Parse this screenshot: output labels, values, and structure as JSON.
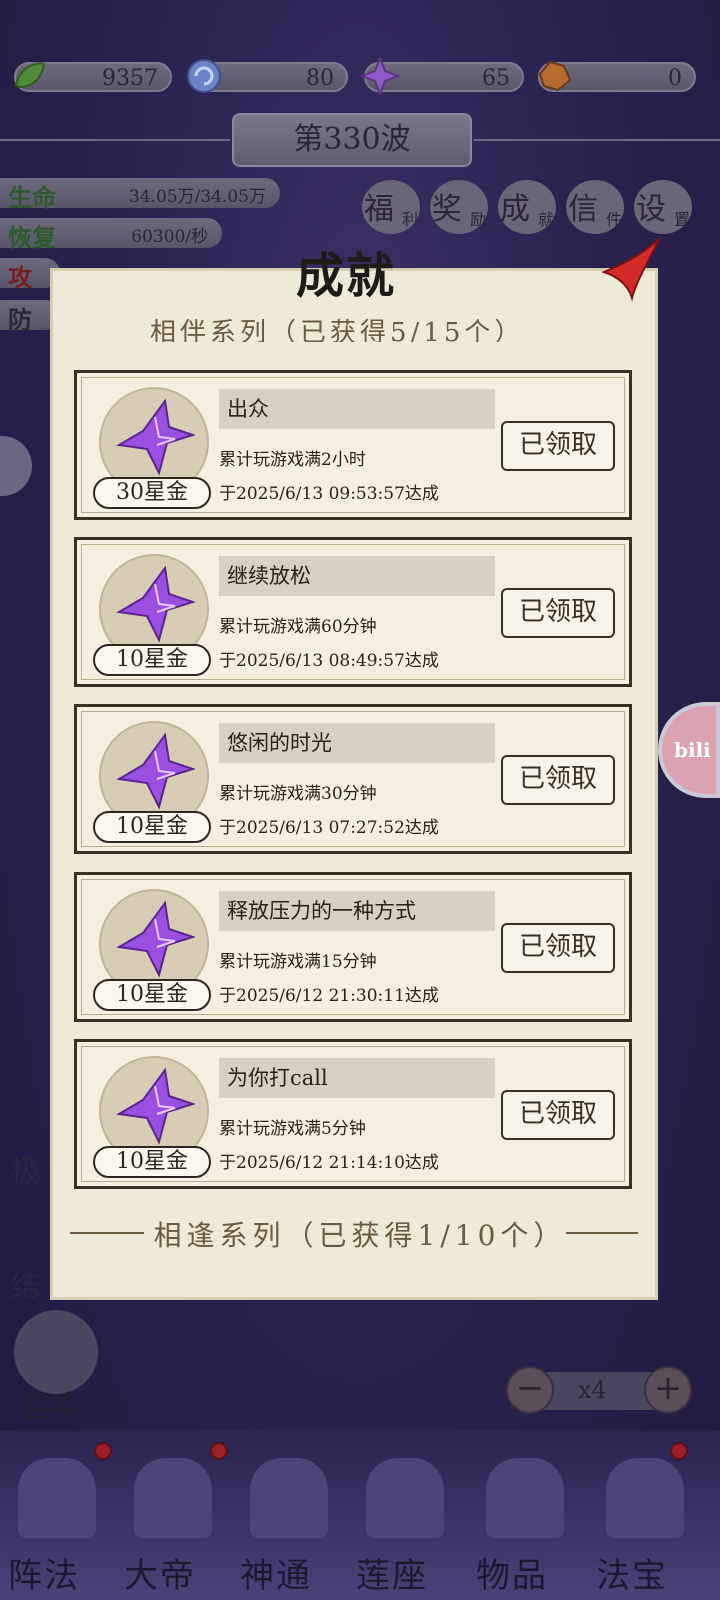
{
  "resources": [
    {
      "icon": "green-leaf-icon",
      "value": "9357"
    },
    {
      "icon": "blue-orb-icon",
      "value": "80"
    },
    {
      "icon": "purple-star-icon",
      "value": "65"
    },
    {
      "icon": "orange-ore-icon",
      "value": "0"
    }
  ],
  "wave": {
    "label": "第330波"
  },
  "stats": [
    {
      "label": "生命",
      "value": "34.05万/34.05万"
    },
    {
      "label": "恢复",
      "value": "60300/秒"
    },
    {
      "label": "攻"
    },
    {
      "label": "防"
    }
  ],
  "quick_buttons": [
    {
      "big": "福",
      "small": "利"
    },
    {
      "big": "奖",
      "small": "励"
    },
    {
      "big": "成",
      "small": "就"
    },
    {
      "big": "信",
      "small": "件"
    },
    {
      "big": "设",
      "small": "置"
    }
  ],
  "modal": {
    "title": "成就",
    "top_series": "相伴系列（已获得5/15个）",
    "cards": [
      {
        "name": "出众",
        "desc": "累计玩游戏满2小时",
        "date": "于2025/6/13 09:53:57达成",
        "reward": "30星金",
        "claim": "已领取"
      },
      {
        "name": "继续放松",
        "desc": "累计玩游戏满60分钟",
        "date": "于2025/6/13 08:49:57达成",
        "reward": "10星金",
        "claim": "已领取"
      },
      {
        "name": "悠闲的时光",
        "desc": "累计玩游戏满30分钟",
        "date": "于2025/6/13 07:27:52达成",
        "reward": "10星金",
        "claim": "已领取"
      },
      {
        "name": "释放压力的一种方式",
        "desc": "累计玩游戏满15分钟",
        "date": "于2025/6/12 21:30:11达成",
        "reward": "10星金",
        "claim": "已领取"
      },
      {
        "name": "为你打call",
        "desc": "累计玩游戏满5分钟",
        "date": "于2025/6/12 21:14:10达成",
        "reward": "10星金",
        "claim": "已领取"
      }
    ],
    "bottom_series": "相逢系列（已获得1/10个）"
  },
  "summon": {
    "label": "召唤"
  },
  "speed": {
    "value": "x4"
  },
  "side_labels": [
    "极",
    "结"
  ],
  "nav": [
    "阵法",
    "大帝",
    "神通",
    "莲座",
    "物品",
    "法宝"
  ],
  "bili": {
    "label": "bili"
  },
  "colors": {
    "accent_red": "#d42a2a",
    "panel": "#efe9d8",
    "gem": "#9b4fe0"
  }
}
